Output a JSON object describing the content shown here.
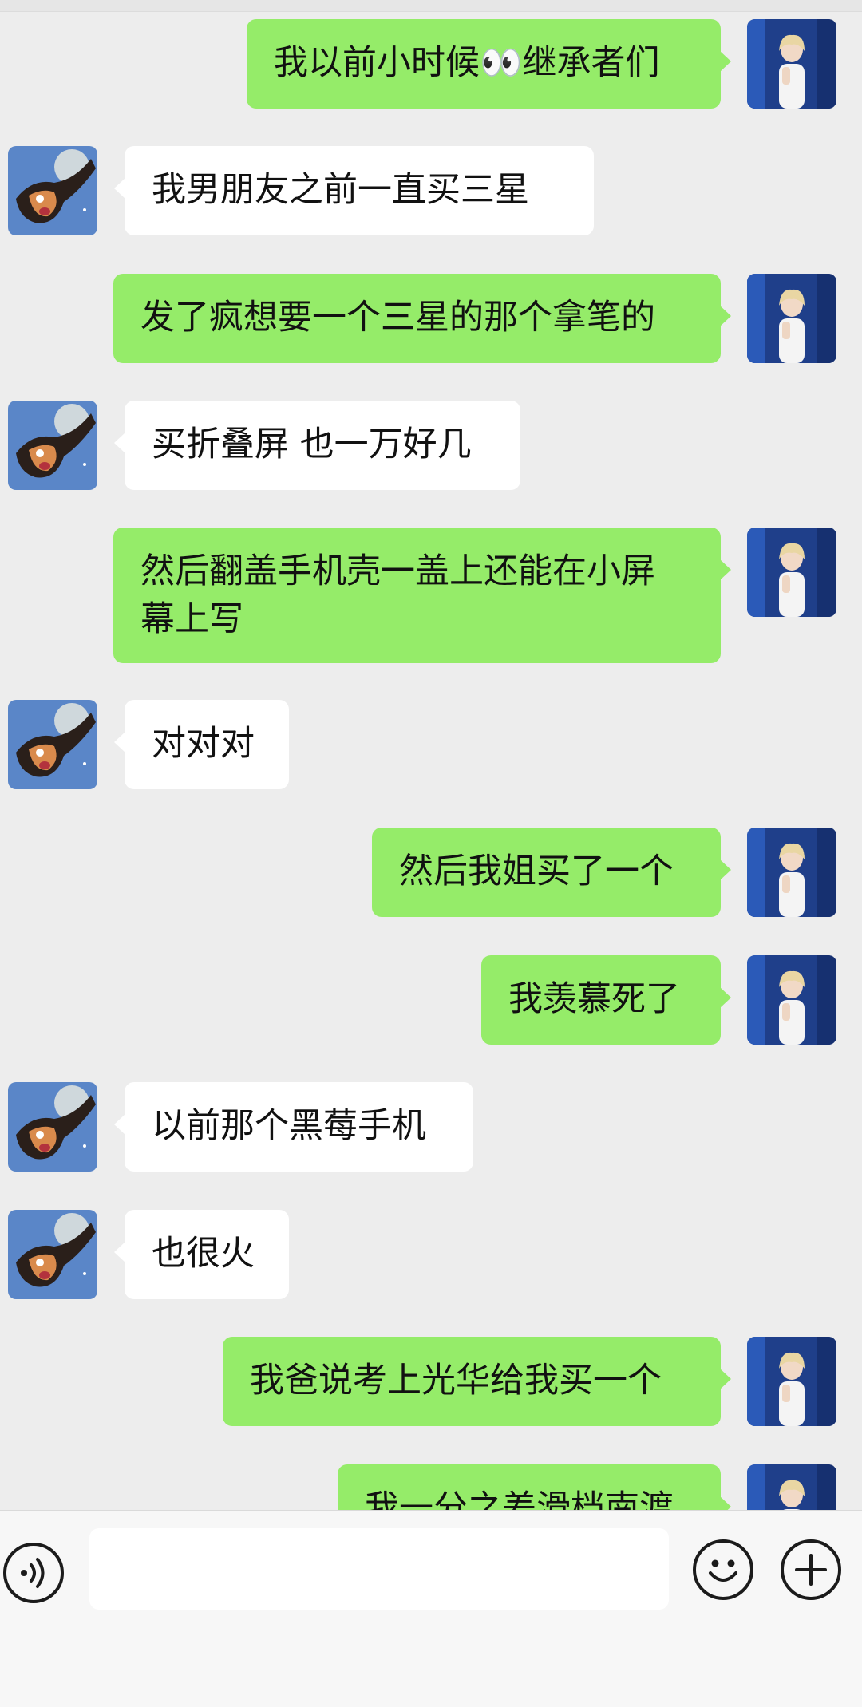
{
  "messages": [
    {
      "side": "out",
      "text": "我以前小时候👀继承者们"
    },
    {
      "side": "in",
      "text": "我男朋友之前一直买三星"
    },
    {
      "side": "out",
      "text": "发了疯想要一个三星的那个拿笔的"
    },
    {
      "side": "in",
      "text": "买折叠屏 也一万好几"
    },
    {
      "side": "out",
      "text": "然后翻盖手机壳一盖上还能在小屏\n幕上写"
    },
    {
      "side": "in",
      "text": "对对对"
    },
    {
      "side": "out",
      "text": "然后我姐买了一个"
    },
    {
      "side": "out",
      "text": "我羡慕死了"
    },
    {
      "side": "in",
      "text": "以前那个黑莓手机"
    },
    {
      "side": "in",
      "text": "也很火"
    },
    {
      "side": "out",
      "text": "我爸说考上光华给我买一个"
    },
    {
      "side": "out",
      "text": "我一分之差滑档南渡"
    }
  ],
  "input_bar": {
    "voice_icon": "voice-icon",
    "emoji_icon": "emoji-icon",
    "plus_icon": "plus-icon",
    "text_value": ""
  },
  "colors": {
    "background": "#ededed",
    "bubble_out": "#95ec69",
    "bubble_in": "#ffffff"
  }
}
